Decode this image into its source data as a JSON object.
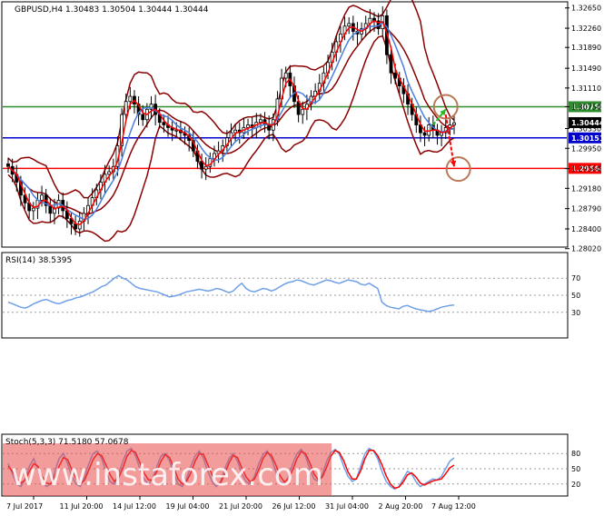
{
  "header": {
    "symbol": "GBPUSD,H4",
    "ohlc": "1.30483 1.30504 1.30444 1.30444"
  },
  "watermark": "www.instaforex.com",
  "colors": {
    "candle": "#000000",
    "bollinger": "#8b0000",
    "ma_fast": "#ff0000",
    "ma_slow": "#4a7fe0",
    "level_green": "#2e8b2e",
    "level_blue": "#0000cc",
    "level_red": "#ff0000",
    "rsi": "#6fa0e8",
    "stoch_main": "#6fa0e8",
    "stoch_signal": "#ff0000",
    "circle": "#b97a57",
    "arrow_up": "#22bb22",
    "arrow_down": "#ff0000",
    "watermark_bg": "#e84a4a"
  },
  "chart_data": [
    {
      "type": "candlestick",
      "panel": "price",
      "ylim": [
        1.2805,
        1.3275
      ],
      "y_ticks": [
        "1.32650",
        "1.32260",
        "1.31890",
        "1.31490",
        "1.31110",
        "1.30750",
        "1.30330",
        "1.29950",
        "1.29560",
        "1.29180",
        "1.28790",
        "1.28400",
        "1.28020"
      ],
      "price_labels": {
        "green": "1.30750",
        "current": "1.30444",
        "blue": "1.30151",
        "red": "1.29564"
      },
      "levels": [
        {
          "price": 1.3075,
          "color": "green"
        },
        {
          "price": 1.30151,
          "color": "blue"
        },
        {
          "price": 1.29564,
          "color": "red"
        }
      ],
      "x_labels": [
        "7 Jul 2017",
        "11 Jul 20:00",
        "14 Jul 12:00",
        "19 Jul 04:00",
        "21 Jul 20:00",
        "26 Jul 12:00",
        "31 Jul 04:00",
        "2 Aug 20:00",
        "7 Aug 12:00"
      ],
      "close": [
        1.296,
        1.2945,
        1.293,
        1.2905,
        1.289,
        1.2875,
        1.288,
        1.2895,
        1.2905,
        1.2885,
        1.287,
        1.288,
        1.2895,
        1.2875,
        1.286,
        1.285,
        1.284,
        1.2855,
        1.287,
        1.2885,
        1.29,
        1.2915,
        1.293,
        1.2945,
        1.295,
        1.296,
        1.3,
        1.306,
        1.3085,
        1.3095,
        1.308,
        1.306,
        1.305,
        1.307,
        1.308,
        1.306,
        1.3045,
        1.304,
        1.3035,
        1.303,
        1.303,
        1.3025,
        1.302,
        1.301,
        1.299,
        1.297,
        1.2955,
        1.296,
        1.2975,
        1.2985,
        1.299,
        1.3,
        1.3015,
        1.3025,
        1.303,
        1.3025,
        1.3035,
        1.304,
        1.3035,
        1.3045,
        1.305,
        1.304,
        1.303,
        1.305,
        1.309,
        1.313,
        1.314,
        1.3115,
        1.3085,
        1.306,
        1.307,
        1.308,
        1.3095,
        1.3105,
        1.312,
        1.314,
        1.316,
        1.318,
        1.32,
        1.3215,
        1.323,
        1.3235,
        1.322,
        1.3215,
        1.3225,
        1.3235,
        1.3245,
        1.324,
        1.3225,
        1.325,
        1.3175,
        1.314,
        1.313,
        1.3115,
        1.31,
        1.308,
        1.306,
        1.304,
        1.3025,
        1.302,
        1.304,
        1.303,
        1.302,
        1.3025,
        1.3035,
        1.304,
        1.3044
      ],
      "annotations": [
        {
          "shape": "circle",
          "at_index": 104,
          "price": 1.3075
        },
        {
          "shape": "circle",
          "at_index": 107,
          "price": 1.2955
        },
        {
          "shape": "arrow-up",
          "from_index": 101,
          "from_price": 1.304,
          "to_index": 104,
          "to_price": 1.307
        },
        {
          "shape": "arrow-down",
          "from_index": 104,
          "from_price": 1.306,
          "to_index": 106,
          "to_price": 1.296
        }
      ]
    },
    {
      "type": "line",
      "panel": "rsi",
      "title": "RSI(14) 38.5395",
      "ylim": [
        0,
        100
      ],
      "y_ticks": [
        "70",
        "50",
        "30"
      ],
      "series": [
        {
          "name": "RSI(14)",
          "values": [
            42,
            40,
            38,
            36,
            35,
            37,
            40,
            42,
            44,
            45,
            43,
            41,
            40,
            42,
            44,
            45,
            47,
            48,
            50,
            52,
            54,
            57,
            60,
            62,
            66,
            70,
            73,
            70,
            68,
            64,
            60,
            58,
            57,
            56,
            55,
            54,
            52,
            50,
            48,
            49,
            50,
            52,
            54,
            55,
            56,
            57,
            56,
            55,
            56,
            58,
            57,
            55,
            53,
            55,
            60,
            64,
            58,
            55,
            54,
            56,
            58,
            57,
            55,
            57,
            60,
            63,
            65,
            66,
            68,
            67,
            65,
            63,
            62,
            64,
            66,
            68,
            67,
            65,
            64,
            66,
            68,
            67,
            66,
            63,
            62,
            64,
            61,
            58,
            42,
            38,
            36,
            35,
            34,
            37,
            38,
            36,
            34,
            33,
            32,
            31,
            32,
            34,
            36,
            37,
            38,
            38.5
          ]
        }
      ]
    },
    {
      "type": "line",
      "panel": "stochastic",
      "title": "Stoch(5,3,3) 71.5180 57.0678",
      "ylim": [
        0,
        100
      ],
      "y_ticks": [
        "80",
        "50",
        "20"
      ],
      "series": [
        {
          "name": "Stoch main",
          "values": [
            60,
            40,
            20,
            15,
            30,
            55,
            70,
            50,
            25,
            15,
            20,
            45,
            70,
            80,
            60,
            35,
            20,
            15,
            35,
            60,
            80,
            85,
            70,
            45,
            25,
            20,
            40,
            65,
            85,
            90,
            75,
            50,
            30,
            20,
            30,
            55,
            75,
            80,
            65,
            40,
            20,
            15,
            30,
            55,
            75,
            85,
            70,
            45,
            25,
            15,
            25,
            50,
            70,
            80,
            65,
            40,
            25,
            20,
            35,
            60,
            78,
            85,
            70,
            45,
            25,
            20,
            35,
            60,
            80,
            88,
            75,
            50,
            30,
            25,
            40,
            65,
            82,
            88,
            78,
            55,
            35,
            25,
            30,
            55,
            80,
            90,
            85,
            70,
            45,
            25,
            15,
            10,
            15,
            30,
            45,
            40,
            25,
            15,
            20,
            25,
            30,
            28,
            35,
            50,
            65,
            71.5
          ]
        },
        {
          "name": "Stoch signal",
          "values": [
            55,
            45,
            30,
            22,
            28,
            45,
            60,
            55,
            35,
            22,
            20,
            35,
            55,
            72,
            68,
            48,
            30,
            20,
            28,
            48,
            68,
            80,
            76,
            58,
            38,
            25,
            32,
            52,
            75,
            86,
            82,
            62,
            42,
            28,
            28,
            45,
            65,
            78,
            72,
            52,
            30,
            20,
            25,
            42,
            65,
            80,
            78,
            58,
            38,
            22,
            22,
            40,
            62,
            76,
            72,
            52,
            34,
            24,
            30,
            48,
            70,
            82,
            76,
            58,
            36,
            24,
            30,
            48,
            70,
            84,
            80,
            62,
            40,
            28,
            34,
            54,
            75,
            86,
            82,
            66,
            44,
            30,
            30,
            46,
            70,
            86,
            86,
            76,
            58,
            36,
            20,
            12,
            14,
            24,
            38,
            42,
            34,
            22,
            18,
            22,
            26,
            28,
            30,
            40,
            52,
            57.1
          ]
        }
      ]
    }
  ]
}
